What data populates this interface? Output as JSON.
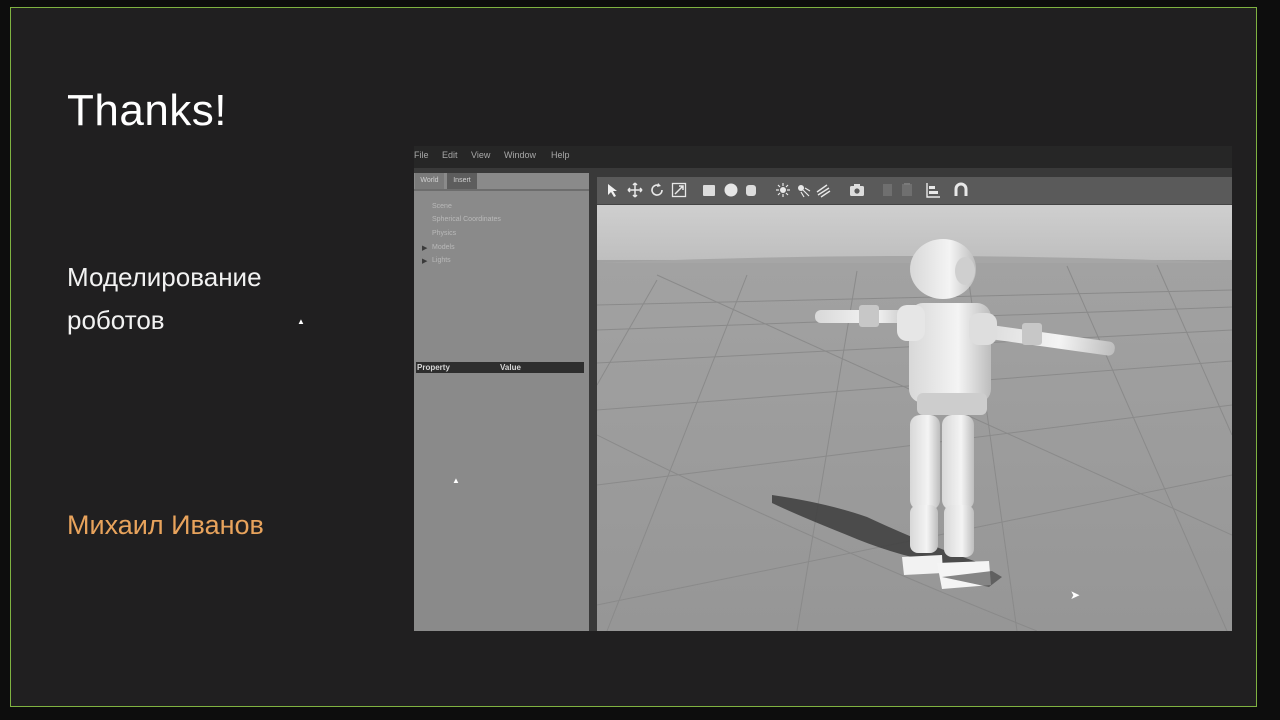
{
  "slide": {
    "title": "Thanks!",
    "subtitle_line1": "Моделирование",
    "subtitle_line2": "роботов",
    "author": "Михаил Иванов",
    "border_color": "#7fb241",
    "author_color": "#e8a35c"
  },
  "app": {
    "menu": [
      "File",
      "Edit",
      "View",
      "Window",
      "Help"
    ],
    "panel_tabs": [
      "World",
      "Insert"
    ],
    "tree": [
      "Scene",
      "Spherical Coordinates",
      "Physics",
      "Models",
      "Lights"
    ],
    "property_columns": [
      "Property",
      "Value"
    ],
    "toolbar_icons": [
      "select-arrow-icon",
      "translate-icon",
      "rotate-icon",
      "scale-icon",
      "box-icon",
      "sphere-icon",
      "cylinder-icon",
      "point-light-icon",
      "spot-light-icon",
      "directional-light-icon",
      "screenshot-icon",
      "copy-icon",
      "paste-icon",
      "align-icon",
      "magnet-icon"
    ]
  }
}
